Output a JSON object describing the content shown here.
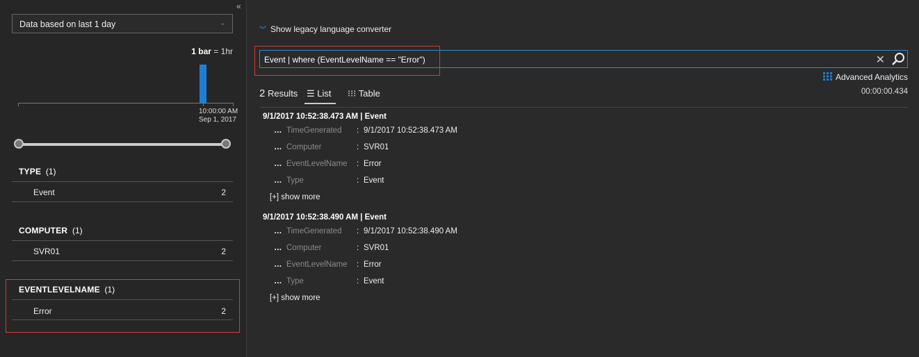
{
  "left_panel": {
    "range_dropdown": "Data based on last 1 day",
    "bar_legend_bold": "1 bar",
    "bar_legend_rest": " = 1hr",
    "histogram": {
      "bars": [
        {
          "time": "10:00:00 AM",
          "date": "Sep 1, 2017",
          "count": 2
        }
      ]
    },
    "facets": [
      {
        "name": "TYPE",
        "count": "(1)",
        "items": [
          {
            "label": "Event",
            "count": "2"
          }
        ]
      },
      {
        "name": "COMPUTER",
        "count": "(1)",
        "items": [
          {
            "label": "SVR01",
            "count": "2"
          }
        ]
      },
      {
        "name": "EVENTLEVELNAME",
        "count": "(1)",
        "items": [
          {
            "label": "Error",
            "count": "2"
          }
        ]
      }
    ]
  },
  "right_panel": {
    "legacy_link": "Show legacy language converter",
    "query": "Event | where (EventLevelName == \"Error\")",
    "advanced_analytics": "Advanced Analytics",
    "elapsed": "00:00:00.434",
    "results_count": "2",
    "results_label": " Results",
    "tabs": {
      "list": "List",
      "table": "Table"
    },
    "records": [
      {
        "title": "9/1/2017 10:52:38.473 AM | Event",
        "fields": [
          {
            "name": "TimeGenerated",
            "value": "9/1/2017 10:52:38.473 AM"
          },
          {
            "name": "Computer",
            "value": "SVR01"
          },
          {
            "name": "EventLevelName",
            "value": "Error"
          },
          {
            "name": "Type",
            "value": "Event"
          }
        ],
        "show_more": "[+] show more"
      },
      {
        "title": "9/1/2017 10:52:38.490 AM | Event",
        "fields": [
          {
            "name": "TimeGenerated",
            "value": "9/1/2017 10:52:38.490 AM"
          },
          {
            "name": "Computer",
            "value": "SVR01"
          },
          {
            "name": "EventLevelName",
            "value": "Error"
          },
          {
            "name": "Type",
            "value": "Event"
          }
        ],
        "show_more": "[+] show more"
      }
    ]
  },
  "colors": {
    "accent": "#1d7fd4",
    "highlight": "#d63a3a",
    "background": "#252525"
  },
  "icons": [
    "collapse-left-icon",
    "chevron-down-icon",
    "search-icon",
    "clear-icon",
    "list-icon",
    "table-icon",
    "advanced-analytics-icon"
  ]
}
